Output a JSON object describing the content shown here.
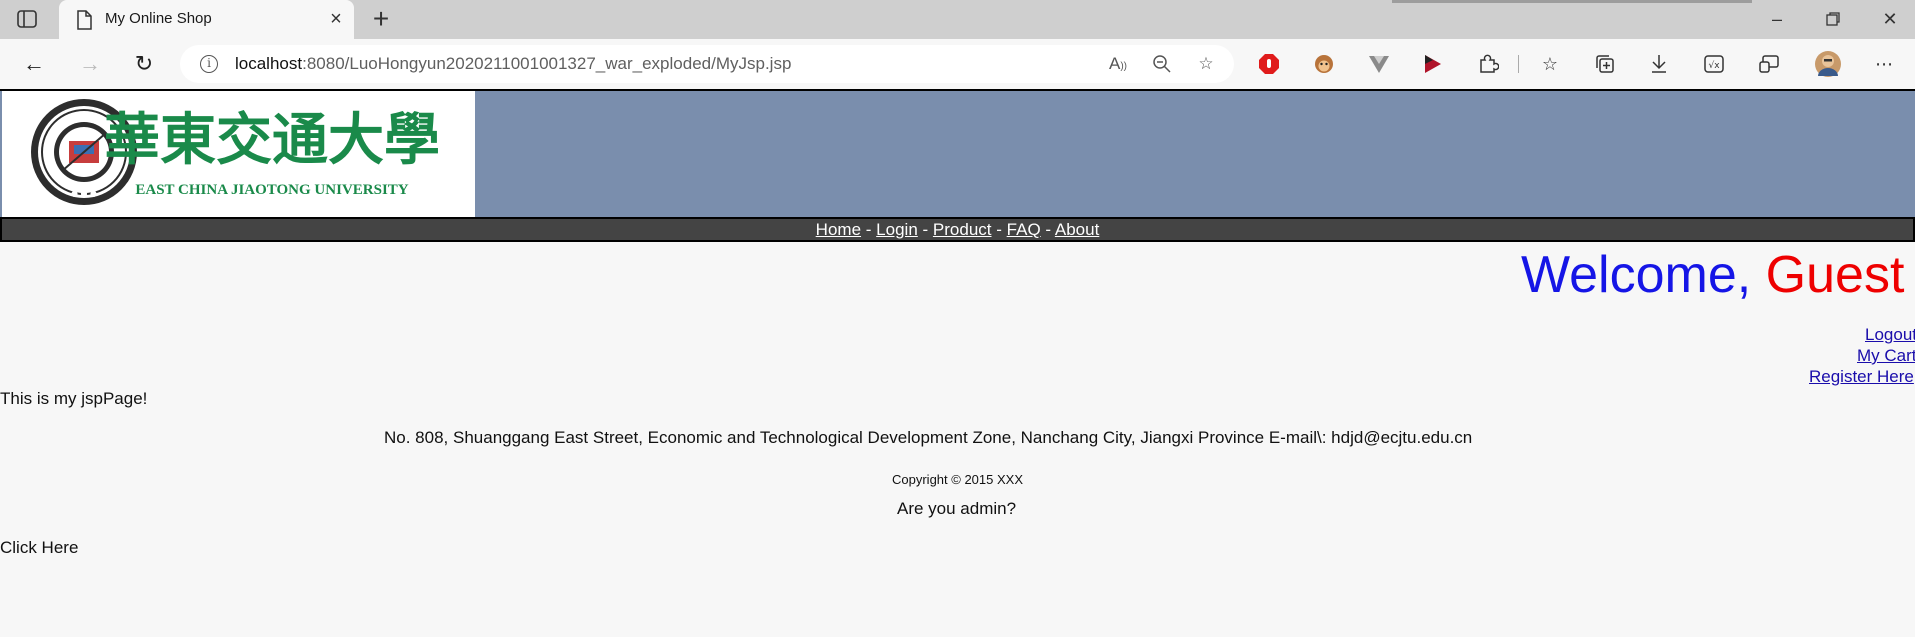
{
  "browser": {
    "tab_title": "My Online Shop",
    "url_host": "localhost",
    "url_path": ":8080/LuoHongyun2020211001001327_war_exploded/MyJsp.jsp"
  },
  "site": {
    "university_cn": "華東交通大學",
    "university_en": "EAST CHINA JIAOTONG UNIVERSITY",
    "nav": [
      "Home",
      "Login",
      "Product",
      "FAQ",
      "About"
    ],
    "nav_separator": "-",
    "welcome_prefix": "Welcome,",
    "welcome_user": "Guest",
    "user_links": [
      "Logout",
      "My Cart",
      "Register Here"
    ],
    "body_text": "This is my jspPage!",
    "address": "No. 808, Shuanggang East Street, Economic and Technological Development Zone, Nanchang City, Jiangxi Province E-mail\\: hdjd@ecjtu.edu.cn",
    "copyright": "Copyright © 2015 XXX",
    "admin_question": "Are you admin?",
    "click_here": "Click Here"
  },
  "colors": {
    "header_bg": "#7a8ead",
    "navbar_bg": "#444444",
    "welcome_blue": "#1515e6",
    "welcome_red": "#ee0000",
    "logo_green": "#1a8a4a"
  }
}
